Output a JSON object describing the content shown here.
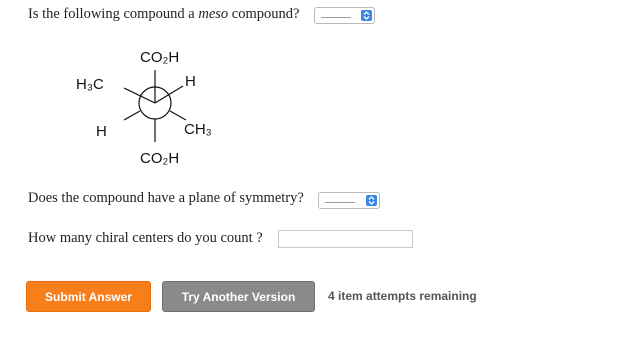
{
  "question1": {
    "text_before": "Is the following compound a ",
    "text_italic": "meso",
    "text_after": " compound?",
    "selected_value": ""
  },
  "molecule": {
    "front_top": "CO₂H",
    "front_left": "H₃C",
    "front_right": "H",
    "back_left": "H",
    "back_right": "CH₃",
    "back_bottom": "CO₂H"
  },
  "question2": {
    "text": "Does the compound have a plane of symmetry?",
    "selected_value": ""
  },
  "question3": {
    "text": "How many chiral centers do you count ?",
    "value": ""
  },
  "actions": {
    "submit_label": "Submit Answer",
    "try_label": "Try Another Version",
    "attempts_text": "4 item attempts remaining"
  },
  "colors": {
    "submit": "#f77e1a",
    "try_another": "#8a8a8a",
    "select_arrow": "#3b87e6"
  },
  "icons": {
    "select_arrow": "up-down-chevron-icon"
  }
}
